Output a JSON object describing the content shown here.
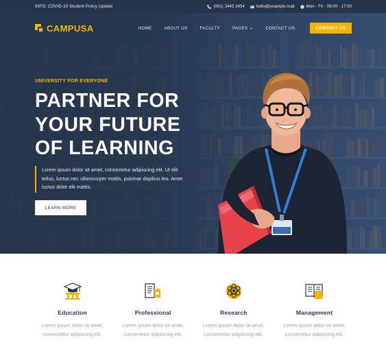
{
  "topbar": {
    "info": "INFO: COVID-19 Student Policy Update",
    "phone": "(001) 3445 3454",
    "email": "hello@example.mail",
    "hours": "Mon - Fri : 08:00 - 17:00"
  },
  "brand": {
    "name": "CAMPUSA",
    "accent": "#f5b400",
    "navy": "#24344b"
  },
  "nav": {
    "items": [
      {
        "label": "HOME"
      },
      {
        "label": "ABOUT US"
      },
      {
        "label": "FACULTY"
      },
      {
        "label": "PAGES"
      },
      {
        "label": "CONTACT US"
      }
    ],
    "cta": "CONTACT US"
  },
  "hero": {
    "eyebrow": "UNIVERSITY FOR EVERYONE",
    "headline": [
      "PARTNER FOR",
      "YOUR FUTURE",
      "OF LEARNING"
    ],
    "lead": "Lorem ipsum dolor sit amet, consectetur adipiscing elit. Ut elit tellus, luctus nec ullamcorper mattis, pulvinar dapibus leo. Amet luctus dolor elit mattis.",
    "button": "LEARN MORE"
  },
  "features": [
    {
      "icon": "education-icon",
      "title": "Education",
      "text": "Lorem ipsum dolor sit amet, consectetur adipiscing elit."
    },
    {
      "icon": "professional-icon",
      "title": "Professional",
      "text": "Lorem ipsum dolor sit amet, consectetur adipiscing elit."
    },
    {
      "icon": "research-icon",
      "title": "Research",
      "text": "Lorem ipsum dolor sit amet, consectetur adipiscing elit."
    },
    {
      "icon": "management-icon",
      "title": "Management",
      "text": "Lorem ipsum dolor sit amet, consectetur adipiscing elit."
    }
  ]
}
